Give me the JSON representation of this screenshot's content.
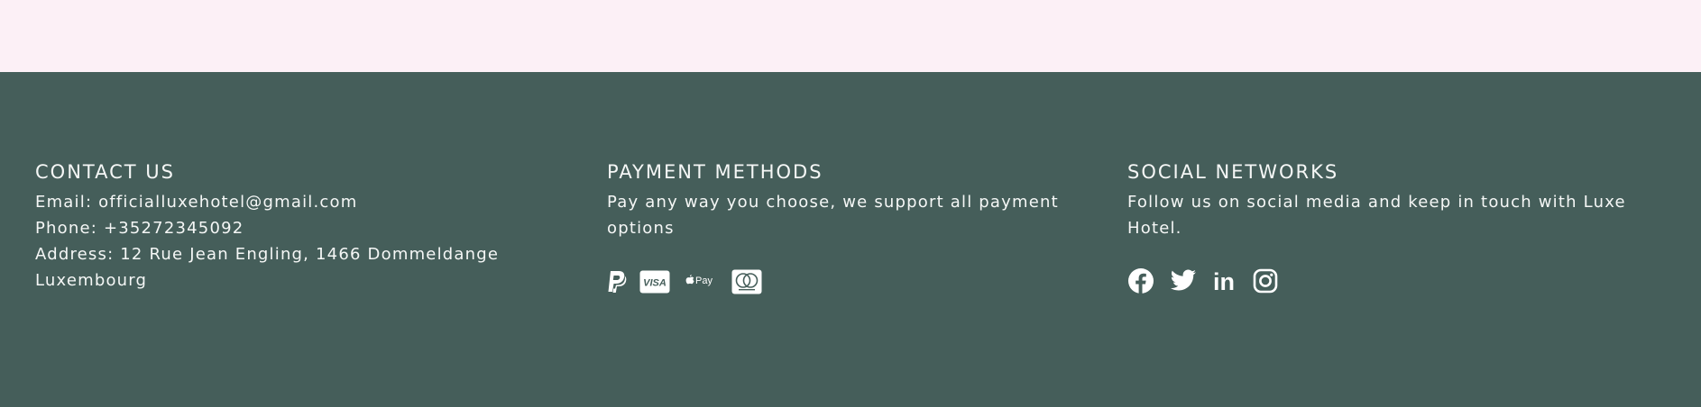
{
  "colors": {
    "top_band": "#fcf0f6",
    "footer_bg": "#455e5a",
    "text": "#f5f7f6"
  },
  "contact": {
    "heading": "CONTACT US",
    "email": "Email: officialluxehotel@gmail.com",
    "phone": "Phone: +35272345092",
    "address_line1": "Address: 12 Rue Jean Engling, 1466 Dommeldange",
    "address_line2": "Luxembourg"
  },
  "payment": {
    "heading": "PAYMENT METHODS",
    "description": "Pay any way you choose, we support all payment options",
    "icons": [
      "paypal-icon",
      "visa-icon",
      "apple-pay-icon",
      "mastercard-icon"
    ],
    "visa_text": "VISA",
    "apple_pay_text": "Pay"
  },
  "social": {
    "heading": "SOCIAL NETWORKS",
    "description": "Follow us on social media and keep in touch with Luxe Hotel.",
    "icons": [
      "facebook-icon",
      "twitter-icon",
      "linkedin-icon",
      "instagram-icon"
    ],
    "linkedin_text": "in"
  }
}
